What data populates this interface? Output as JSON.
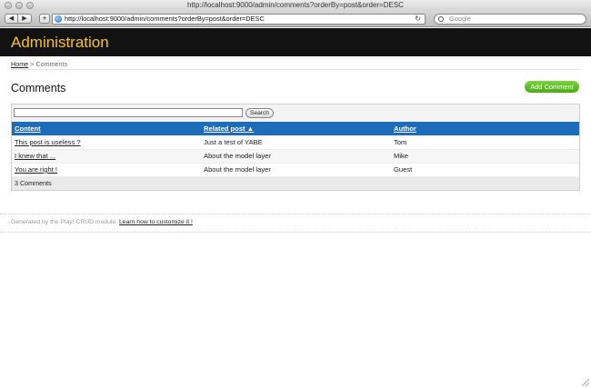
{
  "browser": {
    "window_title": "http://localhost:9000/admin/comments?orderBy=post&order=DESC",
    "url": "http://localhost:9000/admin/comments?orderBy=post&order=DESC",
    "search_placeholder": "Google"
  },
  "header": {
    "title": "Administration"
  },
  "breadcrumb": {
    "home": "Home",
    "separator": ">",
    "current": "Comments"
  },
  "page": {
    "title": "Comments",
    "add_button": "Add Comment"
  },
  "search": {
    "button": "Search"
  },
  "table": {
    "columns": [
      "Content",
      "Related post ▲",
      "Author"
    ],
    "rows": [
      {
        "content": "This post is useless ?",
        "post": "Just a test of YABE",
        "author": "Tom"
      },
      {
        "content": "I knew that ...",
        "post": "About the model layer",
        "author": "Mike"
      },
      {
        "content": "You are right !",
        "post": "About the model layer",
        "author": "Guest"
      }
    ],
    "count": "3 Comments"
  },
  "footer": {
    "text": "Generated by the Play! CRUD module.",
    "link": "Learn how to customize it !"
  },
  "colors": {
    "header_bg": "#121212",
    "title": "#f5c418",
    "table_header": "#1c6cba",
    "add_button": "#5cb82a"
  }
}
